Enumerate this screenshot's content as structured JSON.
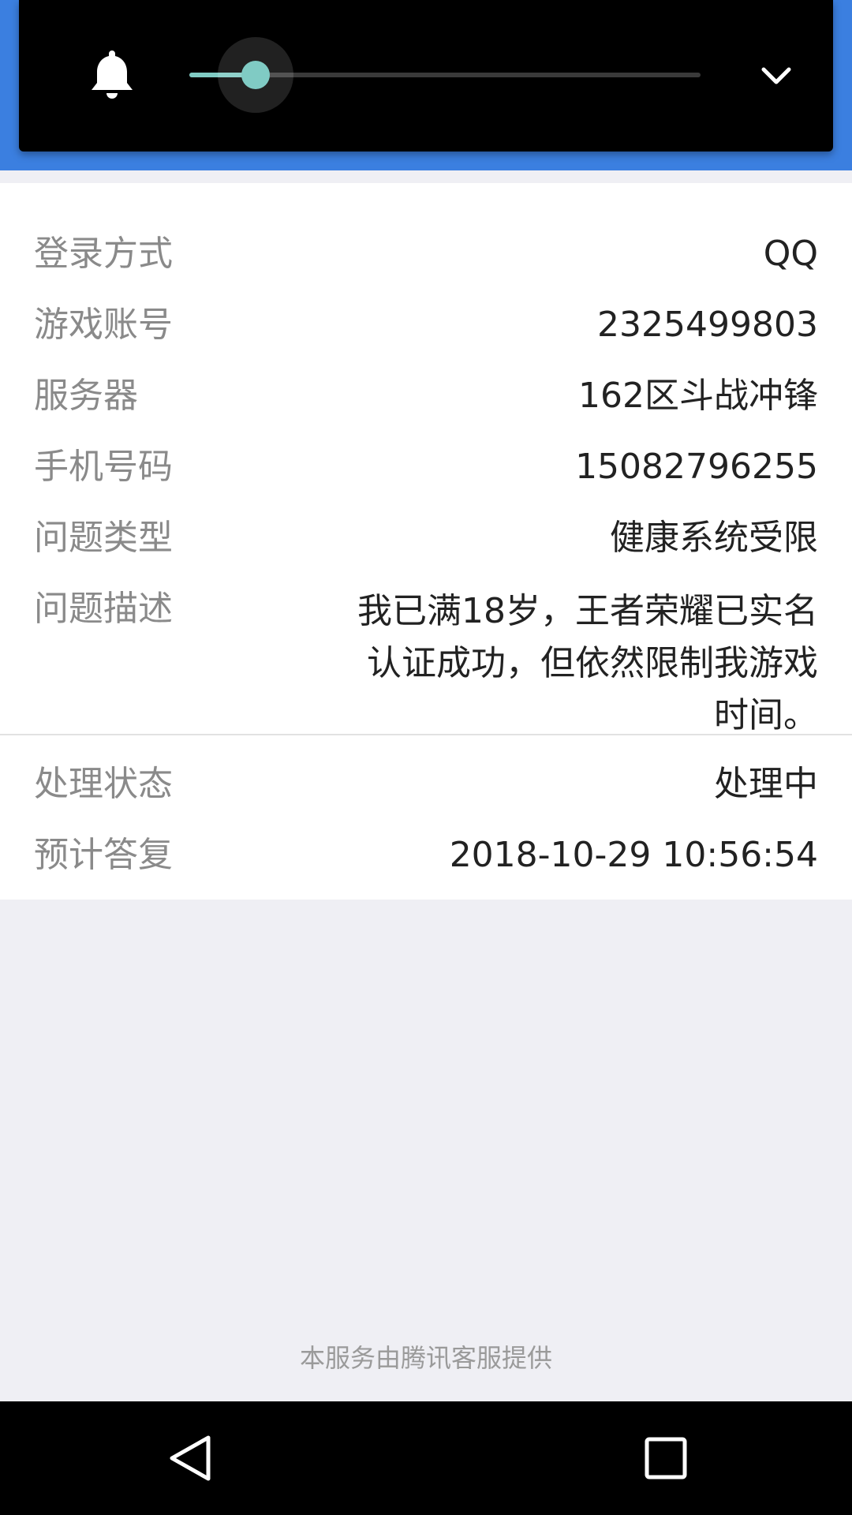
{
  "volume_panel": {
    "bell_icon": "bell-icon",
    "expand_icon": "chevron-down-icon",
    "volume_level": 0.13,
    "accent_color": "#80cbc4"
  },
  "details": {
    "rows": [
      {
        "label": "登录方式",
        "value": "QQ"
      },
      {
        "label": "游戏账号",
        "value": "2325499803"
      },
      {
        "label": "服务器",
        "value": "162区斗战冲锋"
      },
      {
        "label": "手机号码",
        "value": "15082796255"
      },
      {
        "label": "问题类型",
        "value": "健康系统受限"
      },
      {
        "label": "问题描述",
        "value": "我已满18岁，王者荣耀已实名认证成功，但依然限制我游戏时间。"
      }
    ]
  },
  "status": {
    "rows": [
      {
        "label": "处理状态",
        "value": "处理中"
      },
      {
        "label": "预计答复",
        "value": "2018-10-29 10:56:54"
      }
    ]
  },
  "footer": {
    "text": "本服务由腾讯客服提供"
  },
  "nav_bar": {
    "back_icon": "back-triangle-icon",
    "recents_icon": "recents-square-icon"
  },
  "colors": {
    "header_blue": "#3b7fe0",
    "page_background": "#efeff4"
  }
}
